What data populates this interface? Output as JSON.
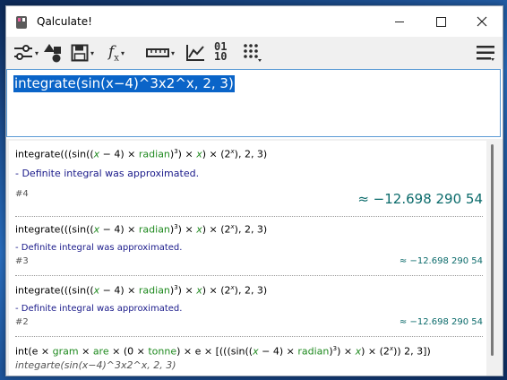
{
  "window": {
    "title": "Qalculate!"
  },
  "toolbar": {
    "buttons": [
      "sliders-icon",
      "shapes-icon",
      "save-icon",
      "function-icon",
      "ruler-icon",
      "plot-icon",
      "binary-icon",
      "keypad-icon",
      "menu-icon"
    ],
    "function_label": "fx",
    "binary_label_top": "01",
    "binary_label_bottom": "10"
  },
  "input": {
    "value": "integrate(sin(x−4)^3x2^x, 2, 3)"
  },
  "history": {
    "entries": [
      {
        "expr_prefix": "integrate(((sin((",
        "x": "x",
        "minus4": " − 4) × ",
        "radian": "radian",
        "close": ")",
        "sup3": "3",
        "times_x": ") × ",
        "x2": "x",
        "close2": ") × (2",
        "supx": "x",
        "tail": "), 2, 3)",
        "note": "- Definite integral was approximated.",
        "index": "#4",
        "result": "≈ −12.698 290 54"
      },
      {
        "expr_prefix": "integrate(((sin((",
        "x": "x",
        "minus4": " − 4) × ",
        "radian": "radian",
        "close": ")",
        "sup3": "3",
        "times_x": ") × ",
        "x2": "x",
        "close2": ") × (2",
        "supx": "x",
        "tail": "), 2, 3)",
        "note": "- Definite integral was approximated.",
        "index": "#3",
        "result": "≈ −12.698 290 54"
      },
      {
        "expr_prefix": "integrate(((sin((",
        "x": "x",
        "minus4": " − 4) × ",
        "radian": "radian",
        "close": ")",
        "sup3": "3",
        "times_x": ") × ",
        "x2": "x",
        "close2": ") × (2",
        "supx": "x",
        "tail": "), 2, 3)",
        "note": "- Definite integral was approximated.",
        "index": "#2",
        "result": "≈ −12.698 290 54"
      }
    ],
    "last": {
      "p1": "int(e × ",
      "gram": "gram",
      "p2": " × ",
      "are": "are",
      "p3": " × (0 × ",
      "tonne": "tonne",
      "p4": ") × e × [(((sin((",
      "x": "x",
      "p5": " − 4) × ",
      "radian": "radian",
      "p6": ")",
      "sup3": "3",
      "p7": ") × ",
      "x2": "x",
      "p8": ") × (2",
      "supx": "x",
      "p9": "))  2, 3])",
      "sub": "integarte(sin(x−4)^3x2^x, 2, 3)"
    }
  }
}
